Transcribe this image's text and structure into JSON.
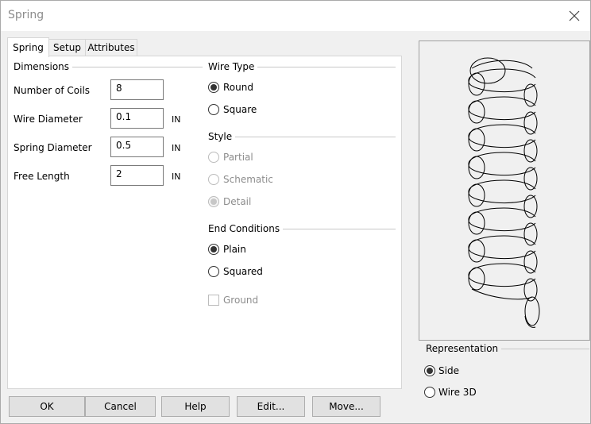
{
  "window": {
    "title": "Spring"
  },
  "tabs": [
    {
      "label": "Spring",
      "active": true
    },
    {
      "label": "Setup",
      "active": false
    },
    {
      "label": "Attributes",
      "active": false
    }
  ],
  "dimensions": {
    "group_label": "Dimensions",
    "number_of_coils": {
      "label": "Number of Coils",
      "value": "8"
    },
    "wire_diameter": {
      "label": "Wire Diameter",
      "value": "0.1",
      "unit": "IN"
    },
    "spring_diameter": {
      "label": "Spring Diameter",
      "value": "0.5",
      "unit": "IN"
    },
    "free_length": {
      "label": "Free Length",
      "value": "2",
      "unit": "IN"
    }
  },
  "wire_type": {
    "group_label": "Wire Type",
    "options": [
      {
        "label": "Round",
        "selected": true
      },
      {
        "label": "Square",
        "selected": false
      }
    ]
  },
  "style": {
    "group_label": "Style",
    "options": [
      {
        "label": "Partial",
        "selected": false,
        "enabled": false
      },
      {
        "label": "Schematic",
        "selected": false,
        "enabled": false
      },
      {
        "label": "Detail",
        "selected": true,
        "enabled": false
      }
    ]
  },
  "end_conditions": {
    "group_label": "End Conditions",
    "options": [
      {
        "label": "Plain",
        "selected": true
      },
      {
        "label": "Squared",
        "selected": false
      }
    ],
    "ground": {
      "label": "Ground",
      "checked": false,
      "enabled": false
    }
  },
  "representation": {
    "group_label": "Representation",
    "options": [
      {
        "label": "Side",
        "selected": true
      },
      {
        "label": "Wire 3D",
        "selected": false
      }
    ]
  },
  "buttons": {
    "ok": "OK",
    "cancel": "Cancel",
    "help": "Help",
    "edit": "Edit...",
    "move": "Move..."
  },
  "preview": {
    "icon": "spring-preview-icon",
    "coils": 8
  }
}
